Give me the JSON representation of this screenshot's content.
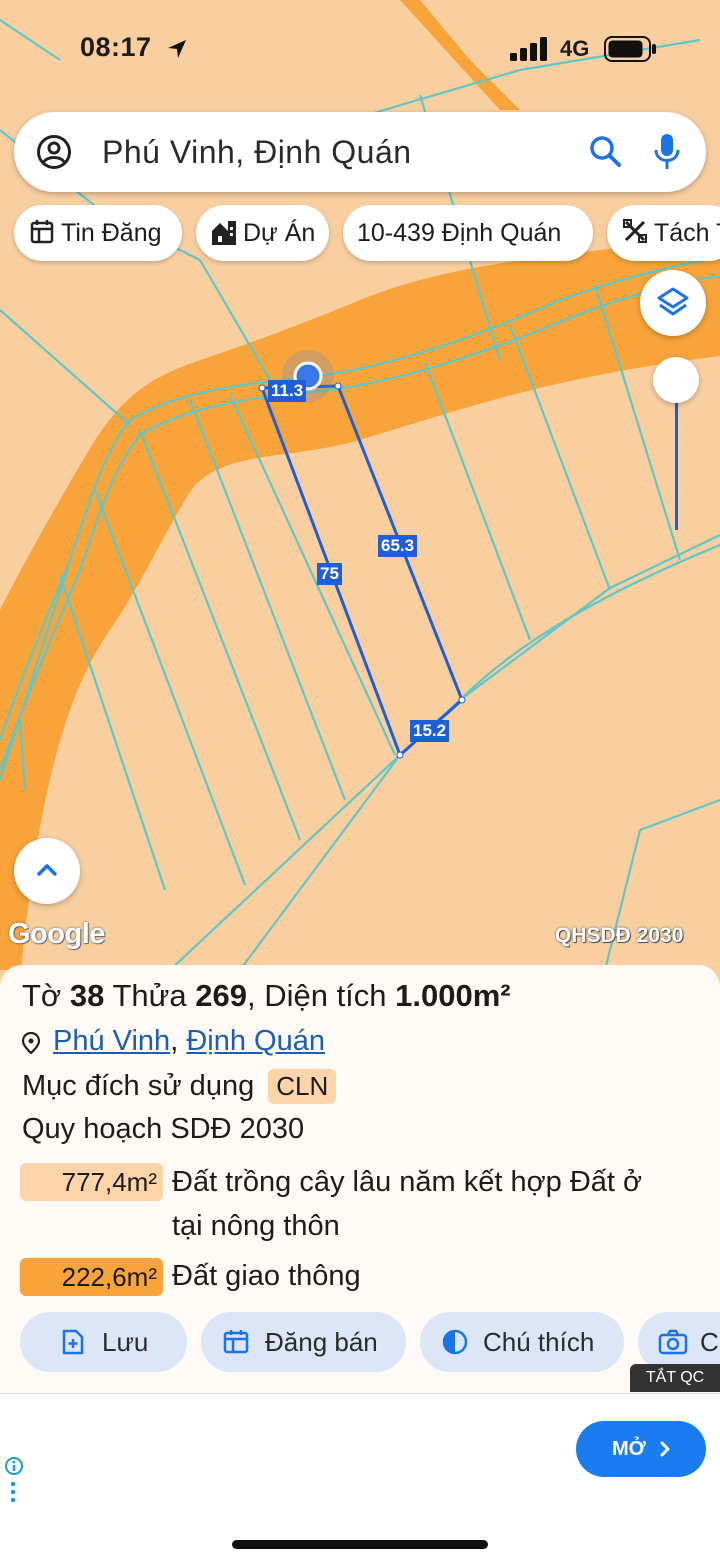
{
  "status_bar": {
    "time": "08:17",
    "network": "4G"
  },
  "search": {
    "query": "Phú Vinh, Định Quán"
  },
  "chips": [
    {
      "label": "Tin Đăng",
      "icon": "calendar-icon"
    },
    {
      "label": "Dự Án",
      "icon": "building-icon"
    },
    {
      "label": "10-439 Định Quán"
    },
    {
      "label": "Tách T",
      "icon": "tools-icon"
    }
  ],
  "map": {
    "edge_labels": [
      "11.3",
      "65.3",
      "75",
      "15.2"
    ],
    "google_logo": "Google",
    "layer_tag": "QHSDĐ 2030"
  },
  "parcel": {
    "to_label": "Tờ",
    "to_value": "38",
    "thua_label": "Thửa",
    "thua_value": "269",
    "area_label": "Diện tích",
    "area_value": "1.000m²",
    "ward": "Phú Vinh",
    "district": "Định Quán",
    "purpose_label": "Mục đích sử dụng",
    "purpose_code": "CLN",
    "plan_title": "Quy hoạch SDĐ 2030",
    "plan_rows": [
      {
        "area": "777,4m²",
        "desc_line1": "Đất trồng cây lâu năm kết hợp Đất ở",
        "desc_line2": "tại nông thôn",
        "color": "#fbd5a9"
      },
      {
        "area": "222,6m²",
        "desc_line1": "Đất giao thông",
        "color": "#f9a43a"
      }
    ]
  },
  "actions": [
    {
      "label": "Lưu",
      "icon": "file-plus-icon"
    },
    {
      "label": "Đăng bán",
      "icon": "calendar-icon"
    },
    {
      "label": "Chú thích",
      "icon": "half-circle-icon"
    },
    {
      "label": "C",
      "icon": "camera-icon"
    }
  ],
  "ad": {
    "close_label": "TẮT QC",
    "open_label": "MỞ"
  },
  "colors": {
    "land": "#f9cfa0",
    "road": "#f8a43a",
    "parcel_line": "#1e5fd8",
    "boundary": "#5fc7c8",
    "accent": "#1a7cf0"
  }
}
